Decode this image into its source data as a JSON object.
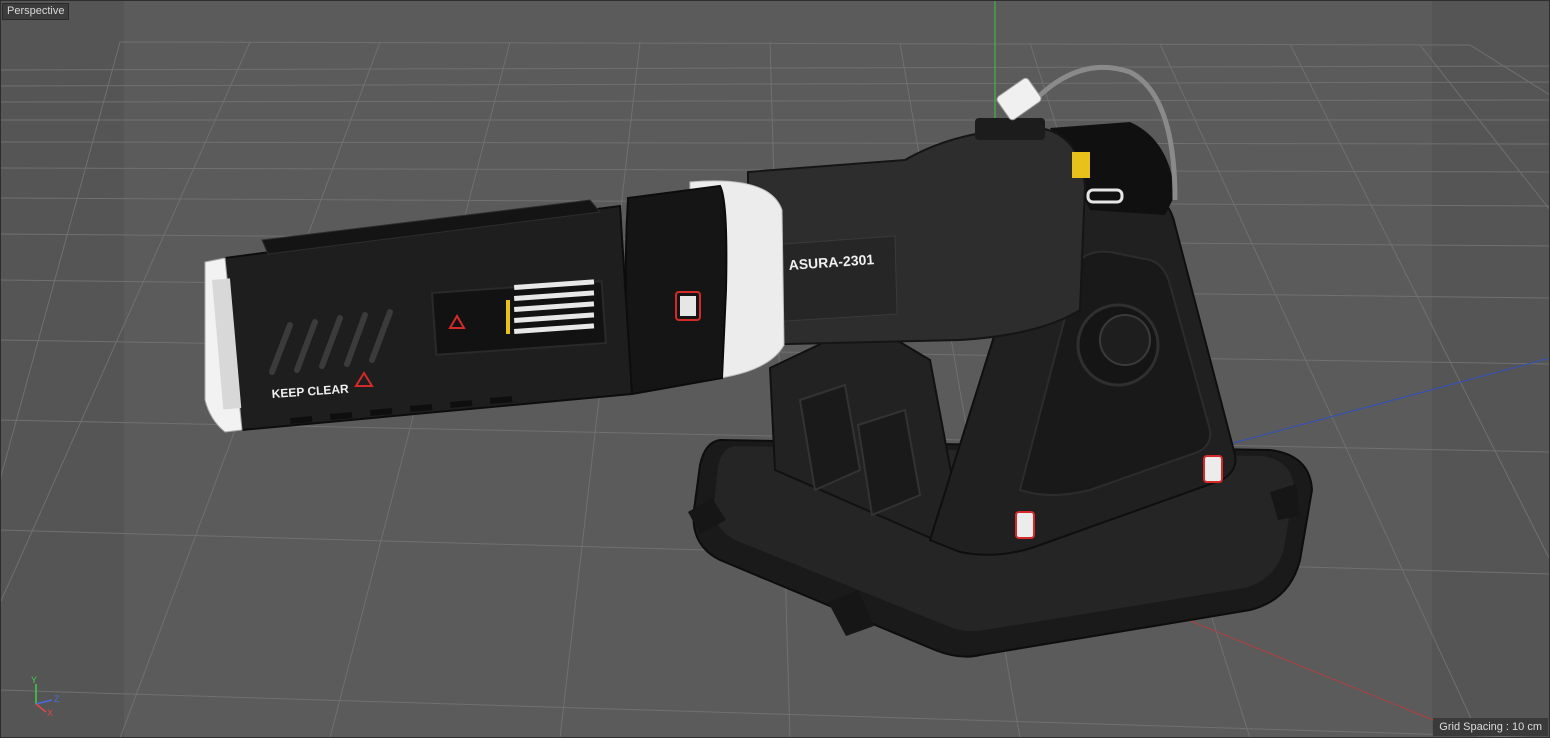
{
  "viewport": {
    "view_label": "Perspective",
    "grid_spacing": "Grid Spacing : 10 cm"
  },
  "axis_gizmo": {
    "y_label": "Y",
    "z_label": "Z",
    "x_label": "X",
    "y_color": "#3fd04a",
    "x_color": "#e04848",
    "z_color": "#4a6ae0"
  },
  "model": {
    "name_plate": "ASURA-2301",
    "warning_text": "KEEP CLEAR",
    "body_color": "#262626",
    "accent_white": "#eeeeee",
    "warning_red": "#d42a2a",
    "hazard_yellow": "#e8c21a"
  },
  "colors": {
    "background": "#5b5b5b",
    "grid_line": "#6e6e6e",
    "world_x_axis": "#b04040",
    "world_y_axis": "#3cc43c",
    "world_z_axis": "#3050c0"
  }
}
